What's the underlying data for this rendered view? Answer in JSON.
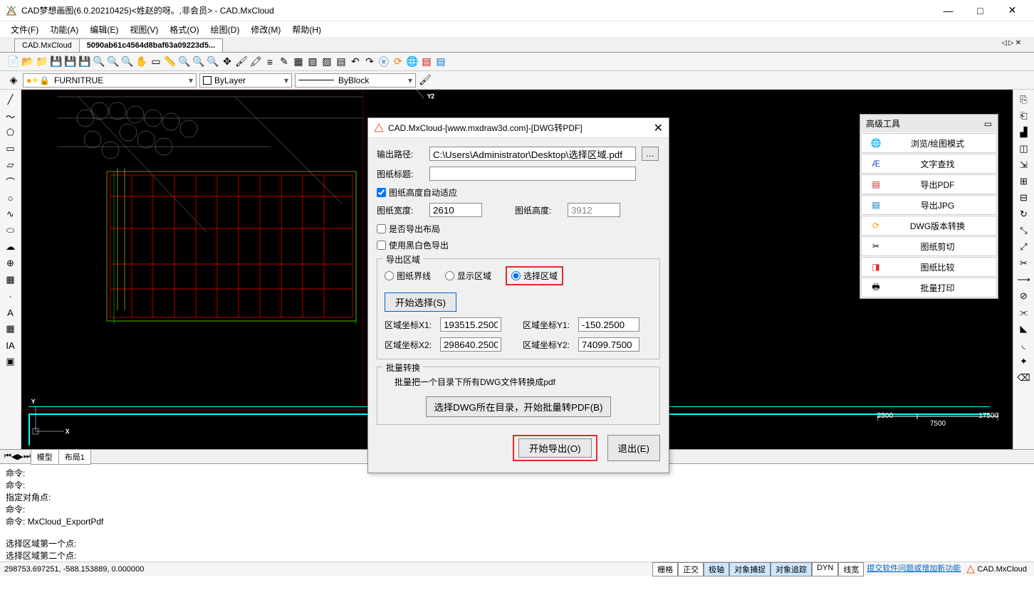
{
  "window": {
    "title": "CAD梦想画图(6.0.20210425)<姓赵的呀。,非会员> - CAD.MxCloud"
  },
  "menus": {
    "file": "文件(F)",
    "func": "功能(A)",
    "edit": "编辑(E)",
    "view": "视图(V)",
    "format": "格式(O)",
    "draw": "绘图(D)",
    "modify": "修改(M)",
    "help": "帮助(H)"
  },
  "tabs": {
    "t1": "CAD.MxCloud",
    "t2": "5090ab61c4564d8baf63a09223d5..."
  },
  "layer": {
    "name": "FURNITRUE",
    "bylayer": "ByLayer",
    "byblock": "ByBlock"
  },
  "adv": {
    "title": "高级工具",
    "browse": "浏览/绘图模式",
    "textfind": "文字查找",
    "exportpdf": "导出PDF",
    "exportjpg": "导出JPG",
    "dwgconv": "DWG版本转换",
    "clip": "图纸剪切",
    "compare": "图纸比较",
    "batchprint": "批量打印"
  },
  "dialog": {
    "title": "CAD.MxCloud-[www.mxdraw3d.com]-[DWG转PDF]",
    "outpath_label": "输出路径:",
    "outpath": "C:\\Users\\Administrator\\Desktop\\选择区域.pdf",
    "title_label": "图纸标题:",
    "title_val": "",
    "autofit": "图纸高度自动适应",
    "width_label": "图纸宽度:",
    "width": "2610",
    "height_label": "图纸高度:",
    "height": "3912",
    "export_layout": "是否导出布局",
    "bw_export": "使用黑白色导出",
    "region_group": "导出区域",
    "r_bounds": "图纸界线",
    "r_display": "显示区域",
    "r_select": "选择区域",
    "start_select": "开始选择(S)",
    "x1_label": "区域坐标X1:",
    "x1": "193515.2500",
    "y1_label": "区域坐标Y1:",
    "y1": "-150.2500",
    "x2_label": "区域坐标X2:",
    "x2": "298640.2500",
    "y2_label": "区域坐标Y2:",
    "y2": "74099.7500",
    "batch_group": "批量转换",
    "batch_desc": "批量把一个目录下所有DWG文件转换成pdf",
    "batch_btn": "选择DWG所在目录，开始批量转PDF(B)",
    "export_btn": "开始导出(O)",
    "exit_btn": "退出(E)"
  },
  "model_tabs": {
    "model": "模型",
    "layout": "布局1"
  },
  "cmd": "命令:\n命令:\n指定对角点:\n命令:\n命令: MxCloud_ExportPdf\n\n选择区域第一个点:\n选择区域第二个点:",
  "status": {
    "coords": "298753.697251,  -588.153889,  0.000000",
    "grid": "栅格",
    "ortho": "正交",
    "polar": "极轴",
    "osnap": "对象捕捉",
    "otrack": "对象追踪",
    "dyn": "DYN",
    "lw": "线宽",
    "feedback": "提交软件问题或增加新功能",
    "brand": "CAD.MxCloud"
  },
  "scale": {
    "t1": "2500",
    "t2": "17500",
    "b1": "7500"
  }
}
